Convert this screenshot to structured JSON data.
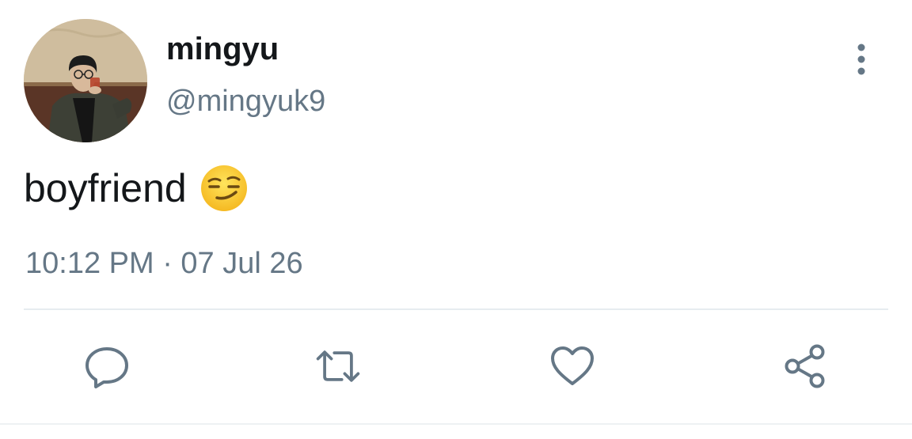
{
  "tweet": {
    "author": {
      "display_name": "mingyu",
      "handle": "@mingyuk9"
    },
    "text": "boyfriend",
    "emoji": "smirking-face",
    "timestamp": "10:12 PM · 07 Jul 26"
  },
  "actions": [
    "reply-icon",
    "retweet-icon",
    "like-icon",
    "share-icon"
  ],
  "colors": {
    "text": "#14171a",
    "secondary": "#657786",
    "divider": "#e6ecf0"
  }
}
